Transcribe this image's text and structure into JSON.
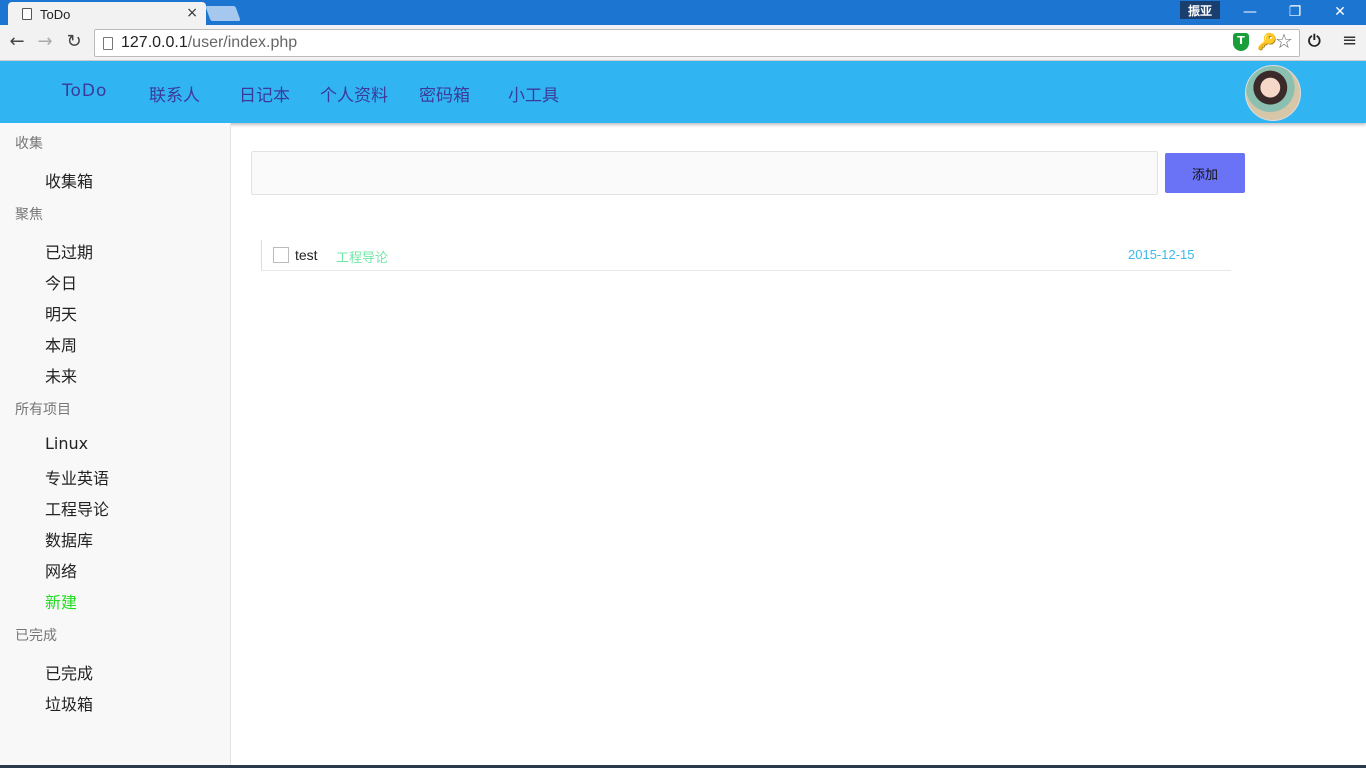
{
  "browser": {
    "tab_title": "ToDo",
    "tab_close": "×",
    "user_badge": "振亚",
    "window_minimize": "—",
    "window_restore": "❐",
    "window_close": "✕",
    "url_host": "127.0.0.1",
    "url_path": "/user/index.php",
    "back": "←",
    "forward": "→",
    "reload": "↻",
    "shield": "T",
    "key": "🔑",
    "star": "☆",
    "power": "⏻",
    "menu": "≡"
  },
  "nav": {
    "brand": "ToDo",
    "links": [
      "联系人",
      "日记本",
      "个人资料",
      "密码箱",
      "小工具"
    ]
  },
  "sidebar": {
    "collect_head": "收集",
    "collect_items": [
      "收集箱"
    ],
    "focus_head": "聚焦",
    "focus_items": [
      "已过期",
      "今日",
      "明天",
      "本周",
      "未来"
    ],
    "projects_head": "所有项目",
    "project_items": [
      "Linux",
      "专业英语",
      "工程导论",
      "数据库",
      "网络"
    ],
    "new_project": "新建",
    "done_head": "已完成",
    "done_items": [
      "已完成",
      "垃圾箱"
    ]
  },
  "main": {
    "add_input_value": "",
    "add_button": "添加",
    "todos": [
      {
        "text": "test",
        "tag": "工程导论",
        "date": "2015-12-15"
      }
    ]
  },
  "colors": {
    "nav_bg": "#31b5f2",
    "nav_text": "#3a3a9a",
    "add_button_bg": "#6a72f6",
    "tag_color": "#6ee7a6",
    "date_color": "#3cb9ea",
    "new_project_color": "#22dd22"
  }
}
